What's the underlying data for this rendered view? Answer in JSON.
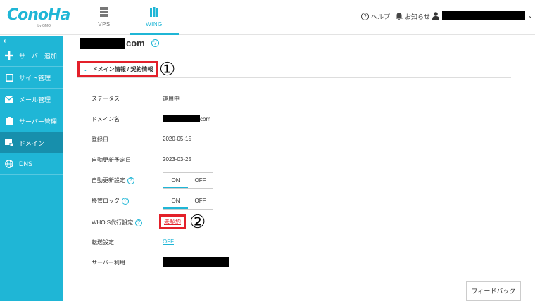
{
  "header": {
    "logo_text": "ConoHa",
    "logo_sub": "by GMO",
    "tabs": [
      {
        "label": "VPS",
        "icon": "server-icon"
      },
      {
        "label": "WING",
        "icon": "building-icon"
      }
    ],
    "help_label": "ヘルプ",
    "notice_label": "お知らせ"
  },
  "sidebar": {
    "collapse_glyph": "‹",
    "items": [
      {
        "label": "サーバー追加",
        "icon": "plus-icon"
      },
      {
        "label": "サイト管理",
        "icon": "site-icon"
      },
      {
        "label": "メール管理",
        "icon": "mail-icon"
      },
      {
        "label": "サーバー管理",
        "icon": "server-manage-icon"
      },
      {
        "label": "ドメイン",
        "icon": "domain-icon",
        "active": true
      },
      {
        "label": "DNS",
        "icon": "globe-icon"
      }
    ]
  },
  "main": {
    "domain_suffix": "com",
    "section_title": "ドメイン情報 / 契約情報",
    "marker1": "①",
    "marker2": "②",
    "rows": {
      "status": {
        "label": "ステータス",
        "value": "運用中"
      },
      "domain_name": {
        "label": "ドメイン名",
        "value": "com"
      },
      "registered": {
        "label": "登録日",
        "value": "2020-05-15"
      },
      "renewal": {
        "label": "自動更新予定日",
        "value": "2023-03-25"
      },
      "auto_renew": {
        "label": "自動更新設定",
        "on": "ON",
        "off": "OFF",
        "selected": "ON"
      },
      "transfer_lock": {
        "label": "移管ロック",
        "on": "ON",
        "off": "OFF",
        "selected": "ON"
      },
      "whois": {
        "label": "WHOIS代行設定",
        "value": "未契約"
      },
      "forwarding": {
        "label": "転送設定",
        "value": "OFF"
      },
      "server_use": {
        "label": "サーバー利用"
      }
    },
    "feedback_label": "フィードバック"
  },
  "colors": {
    "accent": "#1fb6d6",
    "sidebar_active": "#178fac",
    "highlight_red": "#e3202a"
  }
}
